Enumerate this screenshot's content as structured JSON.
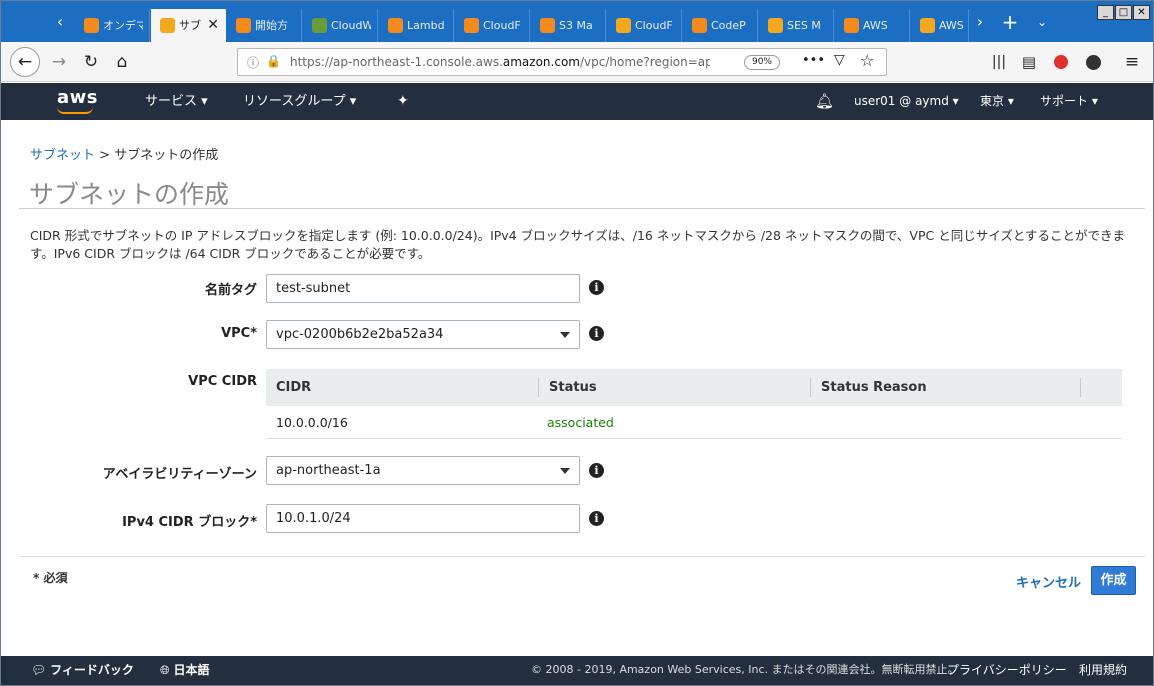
{
  "browser": {
    "tabs": [
      {
        "label": "オンデマ",
        "icon_color": "#f28a1e"
      },
      {
        "label": "サブ",
        "icon_color": "#f2a91e",
        "active": true
      },
      {
        "label": "開始方",
        "icon_color": "#f28a1e"
      },
      {
        "label": "CloudW",
        "icon_color": "#6a9b3a"
      },
      {
        "label": "Lambd",
        "icon_color": "#f28a1e"
      },
      {
        "label": "CloudF",
        "icon_color": "#f28a1e"
      },
      {
        "label": "S3 Ma",
        "icon_color": "#f28a1e"
      },
      {
        "label": "CloudF",
        "icon_color": "#f2a91e"
      },
      {
        "label": "CodeP",
        "icon_color": "#f28a1e"
      },
      {
        "label": "SES M",
        "icon_color": "#f2a91e"
      },
      {
        "label": "AWS",
        "icon_color": "#f28a1e"
      },
      {
        "label": "AWS",
        "icon_color": "#f2a91e"
      }
    ],
    "url_prefix": "https://ap-northeast-1.console.aws.",
    "url_domain": "amazon.com",
    "url_suffix": "/vpc/home?region=ap-",
    "zoom": "90%"
  },
  "aws_header": {
    "logo": "aws",
    "services": "サービス",
    "resource_groups": "リソースグループ",
    "user": "user01 @ aymd",
    "region": "東京",
    "support": "サポート"
  },
  "page": {
    "breadcrumb_link": "サブネット",
    "breadcrumb_sep": ">",
    "breadcrumb_current": "サブネットの作成",
    "title": "サブネットの作成",
    "description": "CIDR 形式でサブネットの IP アドレスブロックを指定します (例: 10.0.0.0/24)。IPv4 ブロックサイズは、/16 ネットマスクから /28 ネットマスクの間で、VPC と同じサイズとすることができます。IPv6 CIDR ブロックは /64 CIDR ブロックであることが必要です。"
  },
  "form": {
    "name_tag_label": "名前タグ",
    "name_tag_value": "test-subnet",
    "vpc_label": "VPC*",
    "vpc_value": "vpc-0200b6b2e2ba52a34",
    "vpc_cidr_label": "VPC CIDR",
    "az_label": "アベイラビリティーゾーン",
    "az_value": "ap-northeast-1a",
    "ipv4_label": "IPv4 CIDR ブロック*",
    "ipv4_value": "10.0.1.0/24",
    "info_glyph": "i"
  },
  "cidr_table": {
    "columns": [
      "CIDR",
      "Status",
      "Status Reason"
    ],
    "rows": [
      {
        "cidr": "10.0.0.0/16",
        "status": "associated",
        "reason": ""
      }
    ],
    "status_color": "#1d8102"
  },
  "actions": {
    "required_note": "* 必須",
    "cancel": "キャンセル",
    "create": "作成"
  },
  "footer": {
    "feedback": "フィードバック",
    "language": "日本語",
    "copyright": "© 2008 - 2019, Amazon Web Services, Inc. またはその関連会社。無断転用禁止。",
    "privacy": "プライバシーポリシー",
    "terms": "利用規約"
  }
}
